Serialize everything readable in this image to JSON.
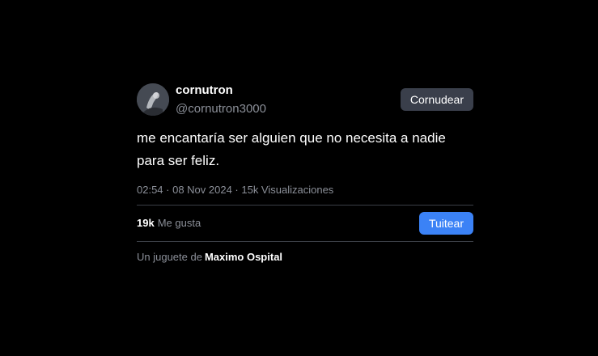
{
  "user": {
    "display_name": "cornutron",
    "handle": "@cornutron3000"
  },
  "follow_button": {
    "label": "Cornudear"
  },
  "tweet": {
    "text": "me encantaría ser alguien que no necesita a nadie para ser feliz.",
    "meta": "02:54 · 08 Nov 2024 · 15k Visualizaciones"
  },
  "likes": {
    "count": "19k",
    "label": "Me gusta"
  },
  "tweet_button": {
    "label": "Tuitear"
  },
  "footer": {
    "prefix": "Un juguete de",
    "author": "Maximo Ospital"
  },
  "colors": {
    "background": "#000000",
    "muted_text": "#8b8f98",
    "follow_button": "#3a3f4b",
    "tweet_button": "#3b82f6",
    "divider": "#3b3f46"
  },
  "icons": {
    "avatar": "profile-photo"
  }
}
